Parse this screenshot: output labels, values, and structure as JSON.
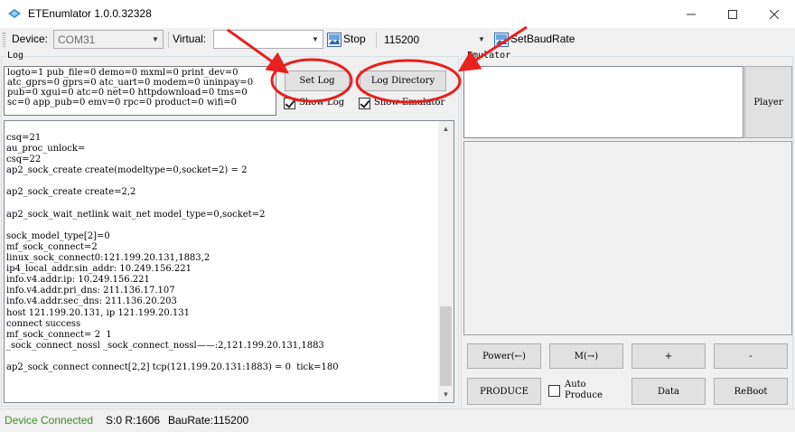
{
  "window": {
    "title": "ETEnumlator 1.0.0.32328",
    "icon": "app-logo-icon",
    "controls": [
      "minimize-icon",
      "maximize-icon",
      "close-icon"
    ]
  },
  "toolbar": {
    "device_label": "Device:",
    "device_value": "COM31",
    "virtual_label": "Virtual:",
    "virtual_value": "",
    "stop_label": "Stop",
    "baud_value": "115200",
    "setbaud_label": "SetBaudRate"
  },
  "log_group": {
    "label": "Log",
    "config_text": "logto=1 pub_file=0 demo=0 mxml=0 print_dev=0\natc_gprs=0 gprs=0 atc_uart=0 modem=0 uninpay=0\npub=0 xgui=0 atc=0 net=0 httpdownload=0 tms=0\nsc=0 app_pub=0 emv=0 rpc=0 product=0 wifi=0",
    "set_log_button": "Set Log",
    "log_directory_button": "Log Directory",
    "show_log_label": "Show Log",
    "show_log_checked": true,
    "show_emulator_label": "Show Emulator",
    "show_emulator_checked": true,
    "output": "csq=21\nau_proc_unlock=\ncsq=22\nap2_sock_create create(modeltype=0,socket=2) = 2\n\nap2_sock_create create=2,2\n\nap2_sock_wait_netlink wait_net model_type=0,socket=2\n\nsock_model_type[2]=0\nmf_sock_connect=2\nlinux_sock_connect0:121.199.20.131,1883,2\nip4_local_addr.sin_addr: 10.249.156.221\ninfo.v4.addr.ip: 10.249.156.221\ninfo.v4.addr.pri_dns: 211.136.17.107\ninfo.v4.addr.sec_dns: 211.136.20.203\nhost 121.199.20.131, ip 121.199.20.131\nconnect success\nmf_sock_connect= 2  1\n_sock_connect_nossl _sock_connect_nossl——:2,121.199.20.131,1883\n\nap2_sock_connect connect[2,2] tcp(121.199.20.131:1883) = 0  tick=180"
  },
  "emulator_group": {
    "label": "Emulator",
    "player_button": "Player",
    "buttons_row1": [
      "Power(←)",
      "M(→)",
      "+",
      "-"
    ],
    "produce_button": "PRODUCE",
    "auto_produce_label": "Auto\nProduce",
    "auto_produce_checked": false,
    "data_button": "Data",
    "reboot_button": "ReBoot"
  },
  "status": {
    "connection": "Device Connected",
    "connection_color": "#3c8c28",
    "counters": "S:0 R:1606",
    "baurate": "BauRate:115200"
  },
  "annotation_color": "#e8201e"
}
